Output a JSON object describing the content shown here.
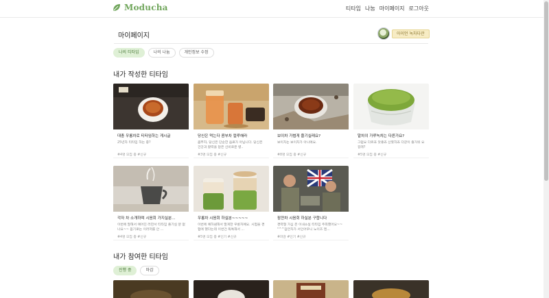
{
  "brand": {
    "name": "Moducha",
    "color": "#6fa55a",
    "icon": "leaf-icon"
  },
  "nav": [
    "티타임",
    "나눔",
    "마이페이지",
    "로그아웃"
  ],
  "mypage": {
    "title": "마이페이지",
    "level": "아이언 녹차다관",
    "tabs": [
      {
        "label": "나의 티타임",
        "active": true
      },
      {
        "label": "나의 나눔",
        "active": false
      },
      {
        "label": "개인정보 수정",
        "active": false
      }
    ]
  },
  "written": {
    "title": "내가 작성한 티타임",
    "cards": [
      {
        "title": "대충 우롱차로 티타임하는 게시글",
        "desc": "25년차 티타임 하는 중?",
        "tags": "#4명 모집 중  #신규"
      },
      {
        "title": "당신은 먹는다 콤부차 컬루해라",
        "desc": "콤부차, 당신은 단순한 음료가 아닙니다. 당신은 건강과 활력을 담은 신비로운 병..",
        "tags": "#3명 모집 중  #신규"
      },
      {
        "title": "보이차 가볍게 즐기실래요?",
        "desc": "보이차는 보이차가 아니에요.",
        "tags": "#8명 모집 중  #신규"
      },
      {
        "title": "말차의 가루녹차는 다른가요?",
        "desc": "그럼요 다르죠 맛좋죠 산뜻하죠 다같이 즐거워 요길래?",
        "tags": "#5명 모집 중  #신규"
      },
      {
        "title": "각자 차 소개하며 시음회 가지실분...",
        "desc": "이번에 말해서 예어진 러한서 티타임 즐기실 분 없나요~~ 듣기로는 이러저를 안 ...",
        "tags": "#4명 모집 중  #신규"
      },
      {
        "title": "우롱차 시음회 하실분~~~~~",
        "desc": "이번에 예하냄해서 말게한 우롱차예요. 시험을 경험에 했다는데 이번건 독특해서 ...",
        "tags": "#5명 모집 중  #인기  #신규"
      },
      {
        "title": "잠깐차 시음회 하실분 구합니다",
        "desc": "경력형 가심 은 이내소실 티타임 주최했어요~~ \"^^잠깐차가 서인어우니 노이즈 멘...",
        "tags": "#마감  #인기  #신규"
      }
    ]
  },
  "joined": {
    "title": "내가 참여한 티타임",
    "filters": [
      {
        "label": "진행 중",
        "active": true
      },
      {
        "label": "마감",
        "active": false
      }
    ]
  }
}
